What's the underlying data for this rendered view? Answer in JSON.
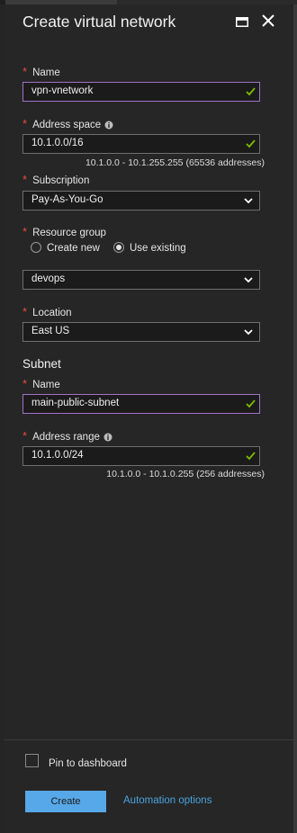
{
  "blade": {
    "title": "Create virtual network"
  },
  "fields": {
    "name": {
      "label": "Name",
      "value": "vpn-vnetwork"
    },
    "address_space": {
      "label": "Address space",
      "value": "10.1.0.0/16",
      "hint": "10.1.0.0 - 10.1.255.255 (65536 addresses)"
    },
    "subscription": {
      "label": "Subscription",
      "value": "Pay-As-You-Go"
    },
    "resource_group": {
      "label": "Resource group",
      "options": [
        "Create new",
        "Use existing"
      ],
      "selected_option": "Use existing",
      "value": "devops"
    },
    "location": {
      "label": "Location",
      "value": "East US"
    }
  },
  "subnet": {
    "heading": "Subnet",
    "name": {
      "label": "Name",
      "value": "main-public-subnet"
    },
    "address_range": {
      "label": "Address range",
      "value": "10.1.0.0/24",
      "hint": "10.1.0.0 - 10.1.0.255 (256 addresses)"
    }
  },
  "footer": {
    "pin_label": "Pin to dashboard",
    "pin_checked": false,
    "create_label": "Create",
    "automation_label": "Automation options"
  },
  "icons": [
    "maximize-icon",
    "close-icon",
    "info-icon",
    "checkmark-icon",
    "chevron-down-icon"
  ],
  "colors": {
    "background": "#262626",
    "required": "#e74c3c",
    "valid": "#7fba00",
    "accent": "#57a8e8",
    "focus_border": "#a172c7"
  }
}
